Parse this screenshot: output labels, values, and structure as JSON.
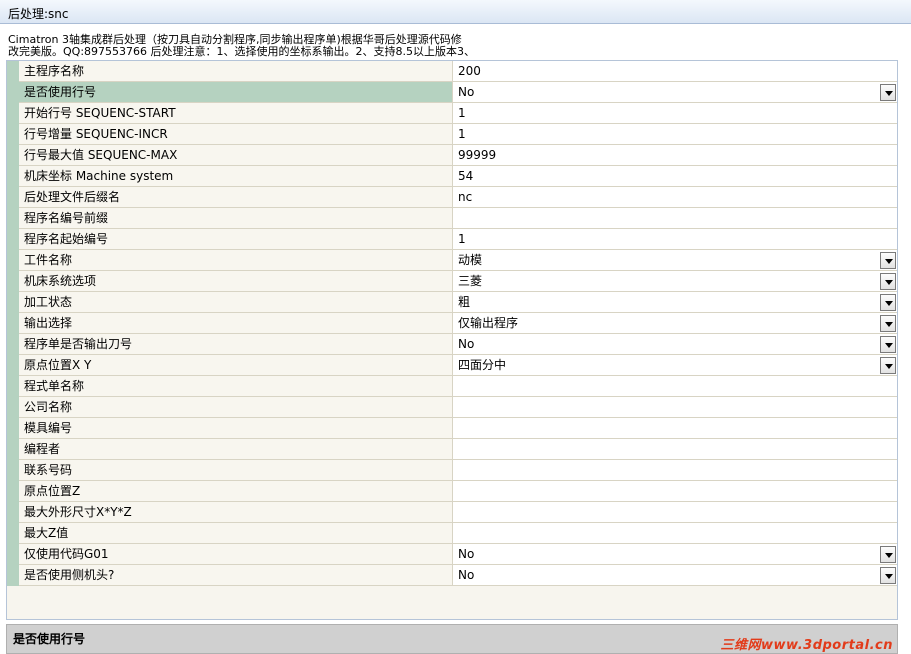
{
  "window": {
    "title": "后处理:snc"
  },
  "description": "Cimatron 3轴集成群后处理（按刀具自动分割程序,同步输出程序单)根据华哥后处理源代码修\n改完美版。QQ:897553766 后处理注意：1、选择使用的坐标系输出。2、支持8.5以上版本3、",
  "rows": [
    {
      "label": "主程序名称",
      "value": "200",
      "dropdown": false
    },
    {
      "label": "是否使用行号",
      "value": "No",
      "dropdown": true,
      "selected": true
    },
    {
      "label": "开始行号 SEQUENC-START",
      "value": "1",
      "dropdown": false
    },
    {
      "label": "行号增量 SEQUENC-INCR",
      "value": "1",
      "dropdown": false
    },
    {
      "label": "行号最大值 SEQUENC-MAX",
      "value": "99999",
      "dropdown": false
    },
    {
      "label": "机床坐标 Machine system",
      "value": "54",
      "dropdown": false
    },
    {
      "label": "后处理文件后缀名",
      "value": "nc",
      "dropdown": false
    },
    {
      "label": "程序名编号前缀",
      "value": "",
      "dropdown": false
    },
    {
      "label": "程序名起始编号",
      "value": "1",
      "dropdown": false
    },
    {
      "label": "工件名称",
      "value": "动模",
      "dropdown": true
    },
    {
      "label": "机床系统选项",
      "value": "三菱",
      "dropdown": true
    },
    {
      "label": "加工状态",
      "value": "粗",
      "dropdown": true
    },
    {
      "label": "输出选择",
      "value": "仅输出程序",
      "dropdown": true
    },
    {
      "label": "程序单是否输出刀号",
      "value": "No",
      "dropdown": true
    },
    {
      "label": "原点位置X Y",
      "value": "四面分中",
      "dropdown": true
    },
    {
      "label": "程式单名称",
      "value": "",
      "dropdown": false
    },
    {
      "label": "公司名称",
      "value": "",
      "dropdown": false
    },
    {
      "label": "模具编号",
      "value": "",
      "dropdown": false
    },
    {
      "label": "编程者",
      "value": "",
      "dropdown": false
    },
    {
      "label": "联系号码",
      "value": "",
      "dropdown": false
    },
    {
      "label": "原点位置Z",
      "value": "",
      "dropdown": false
    },
    {
      "label": "最大外形尺寸X*Y*Z",
      "value": "",
      "dropdown": false
    },
    {
      "label": "最大Z值",
      "value": "",
      "dropdown": false
    },
    {
      "label": "仅使用代码G01",
      "value": "No",
      "dropdown": true
    },
    {
      "label": "是否使用侧机头?",
      "value": "No",
      "dropdown": true
    }
  ],
  "help": {
    "text": "是否使用行号"
  },
  "watermark": {
    "text": "三维网www.3dportal.cn"
  },
  "colors": {
    "selected_row": "#b5d2c0",
    "grid_background": "#f7f5ee",
    "watermark": "#e23b1a"
  }
}
